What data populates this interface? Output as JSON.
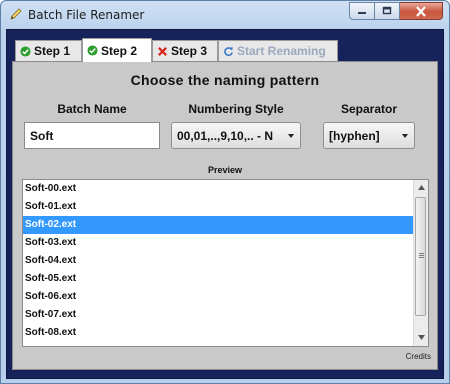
{
  "window": {
    "title": "Batch File Renamer"
  },
  "tabs": [
    {
      "label": "Step  1",
      "icon": "check-circle-icon",
      "color": "#2e9e2e",
      "active": false
    },
    {
      "label": "Step  2",
      "icon": "check-circle-icon",
      "color": "#2e9e2e",
      "active": true
    },
    {
      "label": "Step  3",
      "icon": "x-icon",
      "color": "#d9261c",
      "active": false
    },
    {
      "label": "Start  Renaming",
      "icon": "refresh-icon",
      "color": "#3b78c8",
      "active": false
    }
  ],
  "page": {
    "heading": "Choose  the  naming  pattern",
    "batch_name_label": "Batch  Name",
    "numbering_label": "Numbering  Style",
    "separator_label": "Separator",
    "batch_name_value": "Soft",
    "numbering_value": "00,01,..,9,10,..  -  N",
    "separator_value": "[hyphen]",
    "preview_label": "Preview"
  },
  "preview": {
    "items": [
      "Soft-00.ext",
      "Soft-01.ext",
      "Soft-02.ext",
      "Soft-03.ext",
      "Soft-04.ext",
      "Soft-05.ext",
      "Soft-06.ext",
      "Soft-07.ext",
      "Soft-08.ext"
    ],
    "selected_index": 2
  },
  "footer": {
    "credits": "Credits"
  },
  "colors": {
    "selection": "#3399ff",
    "frame": "#15235a"
  }
}
